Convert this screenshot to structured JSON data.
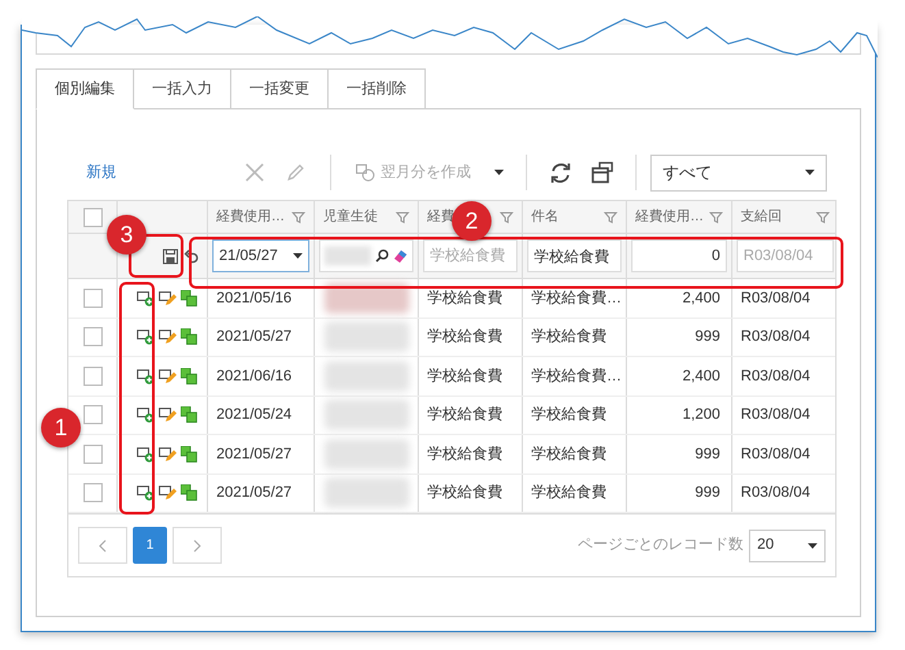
{
  "tabs": [
    {
      "label": "個別編集",
      "selected": true
    },
    {
      "label": "一括入力",
      "selected": false
    },
    {
      "label": "一括変更",
      "selected": false
    },
    {
      "label": "一括削除",
      "selected": false
    }
  ],
  "toolbar": {
    "new_link": "新規",
    "create_next": {
      "label": "翌月分を作成",
      "disabled": true
    },
    "delete_disabled": true,
    "edit_disabled": true,
    "filter_select": "すべて"
  },
  "table": {
    "select_all_checked": false,
    "columns": [
      "経費使用…",
      "児童生徒",
      "経費",
      "件名",
      "経費使用…",
      "支給回"
    ],
    "filter_row": {
      "date": "21/05/27",
      "expense_item_placeholder": "学校給食費",
      "subject": "学校給食費",
      "amount": "0",
      "payment_round_placeholder": "R03/08/04"
    },
    "rows": [
      {
        "checked": false,
        "date": "2021/05/16",
        "expense_item": "学校給食費",
        "subject": "学校給食費…",
        "amount": "2,400",
        "payment_round": "R03/08/04"
      },
      {
        "checked": false,
        "date": "2021/05/27",
        "expense_item": "学校給食費",
        "subject": "学校給食費",
        "amount": "999",
        "payment_round": "R03/08/04"
      },
      {
        "checked": false,
        "date": "2021/06/16",
        "expense_item": "学校給食費",
        "subject": "学校給食費…",
        "amount": "2,400",
        "payment_round": "R03/08/04"
      },
      {
        "checked": false,
        "date": "2021/05/24",
        "expense_item": "学校給食費",
        "subject": "学校給食費",
        "amount": "1,200",
        "payment_round": "R03/08/04"
      },
      {
        "checked": false,
        "date": "2021/05/27",
        "expense_item": "学校給食費",
        "subject": "学校給食費",
        "amount": "999",
        "payment_round": "R03/08/04"
      },
      {
        "checked": false,
        "date": "2021/05/27",
        "expense_item": "学校給食費",
        "subject": "学校給食費",
        "amount": "999",
        "payment_round": "R03/08/04"
      }
    ]
  },
  "pager": {
    "pages": [
      {
        "label": "1",
        "selected": true
      }
    ],
    "page_size_label": "ページごとのレコード数",
    "page_size": "20"
  },
  "annotations": [
    {
      "label": "1"
    },
    {
      "label": "2"
    },
    {
      "label": "3"
    }
  ]
}
